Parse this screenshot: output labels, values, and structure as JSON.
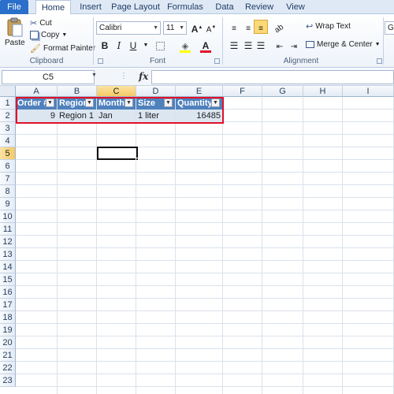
{
  "tabs": [
    "File",
    "Home",
    "Insert",
    "Page Layout",
    "Formulas",
    "Data",
    "Review",
    "View"
  ],
  "ribbon": {
    "clipboard": {
      "paste": "Paste",
      "cut": "Cut",
      "copy": "Copy",
      "format_painter": "Format Painter",
      "label": "Clipboard"
    },
    "font": {
      "name": "Calibri",
      "size": "11",
      "bold": "B",
      "italic": "I",
      "underline": "U",
      "grow": "A",
      "shrink": "A",
      "font_color_letter": "A",
      "label": "Font"
    },
    "alignment": {
      "wrap_text": "Wrap Text",
      "merge_center": "Merge & Center",
      "label": "Alignment"
    },
    "number_format_partial": "Ge"
  },
  "formula_bar": {
    "name_box": "C5",
    "fx": "fx",
    "content": ""
  },
  "columns": [
    "A",
    "B",
    "C",
    "D",
    "E",
    "F",
    "G",
    "H",
    "I"
  ],
  "selected_column": "C",
  "rows": [
    "1",
    "2",
    "3",
    "4",
    "5",
    "6",
    "7",
    "8",
    "9",
    "10",
    "11",
    "12",
    "13",
    "14",
    "15",
    "16",
    "17",
    "18",
    "19",
    "20",
    "21",
    "22",
    "23"
  ],
  "selected_row": "5",
  "table": {
    "headers": [
      "Order #",
      "Region",
      "Month",
      "Size",
      "Quantity"
    ],
    "row": [
      "9",
      "Region 1",
      "Jan",
      "1 liter",
      "16485"
    ]
  },
  "colors": {
    "header_fill": "#4f81bd",
    "row_fill": "#dce6f1",
    "highlight": "#e0102a",
    "selection": "#f5c964"
  }
}
